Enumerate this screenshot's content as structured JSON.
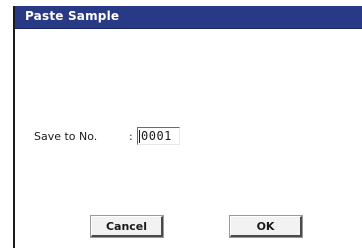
{
  "dialog": {
    "title": "Paste Sample",
    "field": {
      "label": "Save to No.",
      "separator": ":",
      "value": "0001"
    },
    "buttons": {
      "cancel": "Cancel",
      "ok": "OK"
    }
  },
  "colors": {
    "titlebar": "#283a86",
    "title_text": "#ffffff",
    "background": "#ffffff"
  }
}
